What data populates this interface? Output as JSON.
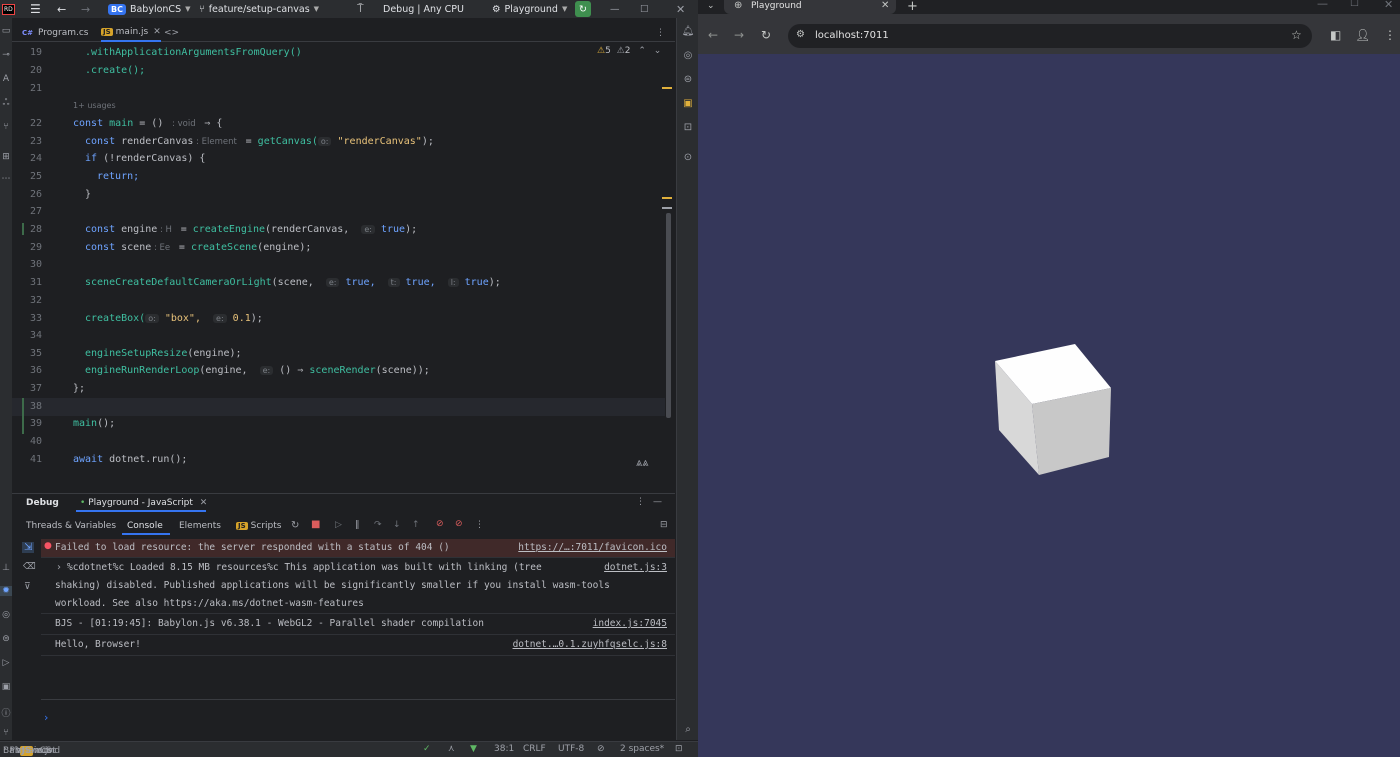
{
  "ide": {
    "project": "BabylonCS",
    "project_badge": "BC",
    "branch": "feature/setup-canvas",
    "build_config": "Debug | Any CPU",
    "run_config": "Playground",
    "tabs": [
      {
        "label": "Program.cs",
        "type": "C#"
      },
      {
        "label": "main.js",
        "type": "JS"
      }
    ],
    "inspections": {
      "warnings": "5",
      "weak_warnings": "2"
    },
    "usages_hint": "1+ usages",
    "hints": {
      "element": "Element",
      "o": "o:",
      "e": "e:",
      "t": "t:",
      "l": "l:",
      "h": "H",
      "ee": "Ee",
      "void": "void"
    },
    "line_numbers": [
      "19",
      "20",
      "21",
      "22",
      "23",
      "24",
      "25",
      "26",
      "27",
      "28",
      "29",
      "30",
      "31",
      "32",
      "33",
      "34",
      "35",
      "36",
      "37",
      "38",
      "39",
      "40",
      "41"
    ]
  },
  "code": {
    "l19": ".withApplicationArgumentsFromQuery()",
    "l20": ".create();",
    "l22_kw": "const",
    "l22_name": "main",
    "l22_rest": "= () ",
    "l22_arrow": "⇒ {",
    "l23_kw": "const",
    "l23_name": "renderCanvas",
    "l23_eq": "=",
    "l23_fn": "getCanvas(",
    "l23_str": "\"renderCanvas\"",
    "l23_end": ");",
    "l24_kw": "if",
    "l24_rest": "(!renderCanvas) {",
    "l25": "return;",
    "l26": "}",
    "l28_kw": "const",
    "l28_name": "engine",
    "l28_eq": "=",
    "l28_fn": "createEngine",
    "l28_args": "(renderCanvas,",
    "l28_val": "true",
    "l28_end": ");",
    "l29_kw": "const",
    "l29_name": "scene",
    "l29_eq": "=",
    "l29_fn": "createScene",
    "l29_args": "(engine);",
    "l31_fn": "sceneCreateDefaultCameraOrLight",
    "l31_args": "(scene,",
    "l31_v1": "true,",
    "l31_v2": "true,",
    "l31_v3": "true",
    "l31_end": ");",
    "l33_fn": "createBox(",
    "l33_str": "\"box\",",
    "l33_num": "0.1",
    "l33_end": ");",
    "l35_fn": "engineSetupResize",
    "l35_args": "(engine);",
    "l36_fn": "engineRunRenderLoop",
    "l36_args": "(engine,",
    "l36_arrow": "() ⇒",
    "l36_fn2": "sceneRender",
    "l36_end": "(scene));",
    "l37": "};",
    "l39_fn": "main",
    "l39_end": "();",
    "l41_kw": "await",
    "l41_rest": "dotnet.run();"
  },
  "debug": {
    "title": "Debug",
    "session_tab": "Playground - JavaScript",
    "subtabs": [
      "Threads & Variables",
      "Console",
      "Elements",
      "Scripts"
    ],
    "scripts_badge": "JS",
    "console": [
      {
        "text": "Failed to load resource: the server responded with a status of 404 ()",
        "link": "https://…:7011/favicon.ico",
        "level": "error"
      },
      {
        "text": "%cdotnet%c Loaded 8.15 MB resources%c This application was built with linking (tree",
        "text2": "shaking) disabled. Published applications will be significantly smaller if you install wasm-tools",
        "text3": "workload. See also https://aka.ms/dotnet-wasm-features",
        "link": "dotnet.js:3",
        "level": "info"
      },
      {
        "text": "BJS - [01:19:45]: Babylon.js v6.38.1 - WebGL2 - Parallel shader compilation",
        "link": "index.js:7045",
        "level": "log"
      },
      {
        "text": "Hello, Browser!",
        "link": "dotnet.…0.1.zuyhfqselc.js:8",
        "level": "log"
      }
    ],
    "prompt": "›"
  },
  "status": {
    "breadcrumb": [
      "BabylonCS",
      "Playground",
      "wwwroot",
      "main.js"
    ],
    "position": "38:1",
    "line_ending": "CRLF",
    "encoding": "UTF-8",
    "indent": "2 spaces*"
  },
  "browser": {
    "tab_title": "Playground",
    "url": "localhost:7011",
    "background": "#35375a",
    "cube_color": "#ffffff"
  }
}
